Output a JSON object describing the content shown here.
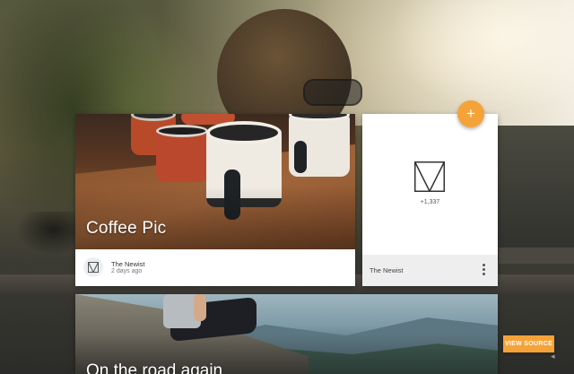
{
  "cards": [
    {
      "title": "Coffee Pic",
      "author": "The Newist",
      "date": "2 days ago"
    },
    {
      "count": "+1,337",
      "author": "The Newist"
    },
    {
      "title": "On the road again"
    }
  ],
  "fab": {
    "label": "+"
  },
  "view_source": {
    "label": "VIEW SOURCE"
  },
  "colors": {
    "accent": "#f5a339",
    "card": "#ffffff",
    "card_footer_gray": "#eeeeee"
  },
  "icons": [
    "logo-icon",
    "more-vert-icon",
    "add-icon"
  ]
}
